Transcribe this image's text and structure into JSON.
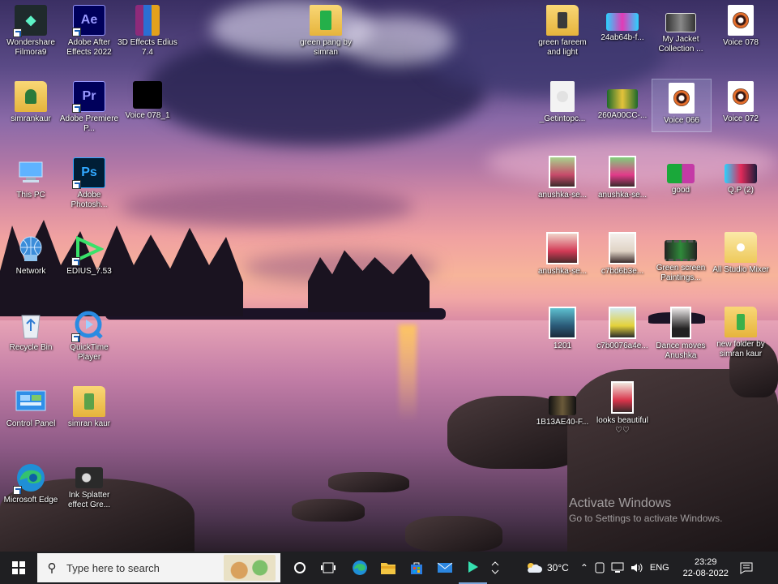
{
  "desktop": {
    "icons": [
      {
        "label": "Wondershare Filmora9",
        "icon": "filmora-icon"
      },
      {
        "label": "Adobe After Effects 2022",
        "icon": "after-effects-icon"
      },
      {
        "label": "3D Effects Edius 7.4",
        "icon": "winrar-icon"
      },
      {
        "label": "simrankaur",
        "icon": "user-folder-icon"
      },
      {
        "label": "Adobe Premiere P...",
        "icon": "premiere-pro-icon"
      },
      {
        "label": "Voice 078_1",
        "icon": "video-file-icon"
      },
      {
        "label": "This PC",
        "icon": "computer-icon"
      },
      {
        "label": "Adobe Photosh...",
        "icon": "photoshop-icon"
      },
      {
        "label": "Network",
        "icon": "network-icon"
      },
      {
        "label": "EDIUS_7.53",
        "icon": "edius-icon"
      },
      {
        "label": "Recycle Bin",
        "icon": "recycle-bin-icon"
      },
      {
        "label": "QuickTime Player",
        "icon": "quicktime-icon"
      },
      {
        "label": "Control Panel",
        "icon": "control-panel-icon"
      },
      {
        "label": "simran kaur",
        "icon": "folder-icon"
      },
      {
        "label": "Microsoft Edge",
        "icon": "edge-icon"
      },
      {
        "label": "Ink Splatter effect Gre...",
        "icon": "image-file-icon"
      },
      {
        "label": "green pang by simran",
        "icon": "folder-icon"
      },
      {
        "label": "green fareem and light",
        "icon": "folder-icon"
      },
      {
        "label": "24ab64b-f...",
        "icon": "image-file-icon"
      },
      {
        "label": "My Jacket Collection ...",
        "icon": "image-file-icon"
      },
      {
        "label": "Voice 078",
        "icon": "audio-file-icon"
      },
      {
        "label": "_Getintopc...",
        "icon": "file-icon"
      },
      {
        "label": "260A00CC-...",
        "icon": "image-file-icon"
      },
      {
        "label": "Voice 066",
        "icon": "audio-file-icon"
      },
      {
        "label": "Voice 072",
        "icon": "audio-file-icon"
      },
      {
        "label": "anushka-se...",
        "icon": "photo-icon"
      },
      {
        "label": "anushka-se...",
        "icon": "photo-icon"
      },
      {
        "label": "good",
        "icon": "image-file-icon"
      },
      {
        "label": "Q.P (2)",
        "icon": "image-file-icon"
      },
      {
        "label": "anushka-se...",
        "icon": "photo-icon"
      },
      {
        "label": "c7bd6b3e...",
        "icon": "photo-icon"
      },
      {
        "label": "Green screen Paintings...",
        "icon": "video-file-icon"
      },
      {
        "label": "All Studio Mixer",
        "icon": "folder-icon"
      },
      {
        "label": "1201",
        "icon": "photo-icon"
      },
      {
        "label": "c7b0076a4e...",
        "icon": "photo-icon"
      },
      {
        "label": "Dance moves Anushka",
        "icon": "video-file-icon"
      },
      {
        "label": "new folder by simran kaur",
        "icon": "folder-icon"
      },
      {
        "label": "1B13AE40-F...",
        "icon": "video-file-icon"
      },
      {
        "label": "looks beautiful ♡♡",
        "icon": "photo-icon"
      }
    ],
    "watermark": {
      "title": "Activate Windows",
      "subtitle": "Go to Settings to activate Windows."
    }
  },
  "taskbar": {
    "search_placeholder": "Type here to search",
    "apps": [
      "task-view-icon",
      "edge-icon",
      "file-explorer-icon",
      "store-icon",
      "mail-icon",
      "filmora-icon"
    ],
    "weather": "30°C",
    "language": "ENG",
    "time": "23:29",
    "date": "22-08-2022"
  }
}
